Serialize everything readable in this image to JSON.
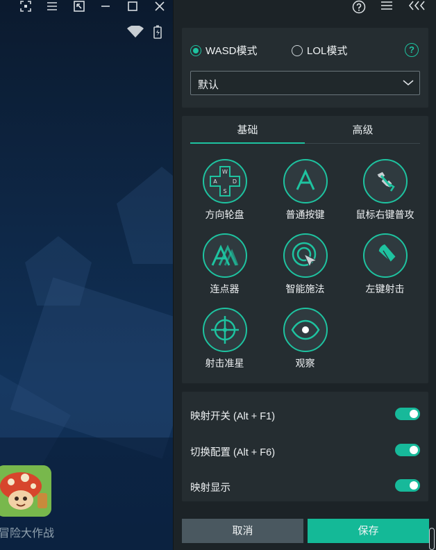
{
  "window": {
    "icons": [
      "screenshot-icon",
      "menu-icon",
      "fit-window-icon",
      "minimize-icon",
      "maximize-icon",
      "close-icon"
    ],
    "status_icons": [
      "wifi-icon",
      "battery-icon"
    ]
  },
  "game": {
    "name": "冒险大作战"
  },
  "panel_top": {
    "icons": [
      "help-icon",
      "menu-icon",
      "collapse-icon"
    ]
  },
  "mode": {
    "options": [
      {
        "label": "WASD模式",
        "selected": true
      },
      {
        "label": "LOL模式",
        "selected": false
      }
    ],
    "preset": "默认"
  },
  "tabs": [
    {
      "label": "基础",
      "active": true
    },
    {
      "label": "高级",
      "active": false
    }
  ],
  "tools": [
    {
      "label": "方向轮盘",
      "icon": "dpad-icon"
    },
    {
      "label": "普通按键",
      "icon": "key-a-icon"
    },
    {
      "label": "鼠标右键普攻",
      "icon": "right-click-icon"
    },
    {
      "label": "连点器",
      "icon": "rapid-click-icon"
    },
    {
      "label": "智能施法",
      "icon": "smart-cast-icon"
    },
    {
      "label": "左键射击",
      "icon": "bullet-icon"
    },
    {
      "label": "射击准星",
      "icon": "crosshair-icon"
    },
    {
      "label": "观察",
      "icon": "eye-icon"
    }
  ],
  "toggles": [
    {
      "label": "映射开关 (Alt + F1)",
      "on": true
    },
    {
      "label": "切换配置 (Alt + F6)",
      "on": true
    },
    {
      "label": "映射显示",
      "on": true
    }
  ],
  "buttons": {
    "cancel": "取消",
    "save": "保存"
  },
  "colors": {
    "accent": "#1ec3a0",
    "panel_bg": "#1c2327",
    "card_bg": "#252d31",
    "cancel_bg": "#4a5860",
    "save_bg": "#14b997"
  }
}
